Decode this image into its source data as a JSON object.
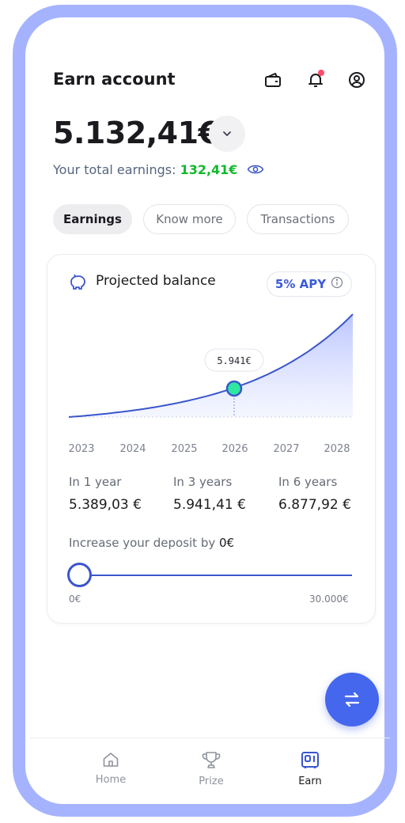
{
  "header": {
    "title": "Earn account",
    "balance": "5.132,41€",
    "earnings_label": "Your total earnings:",
    "earnings_value": "132,41€"
  },
  "tabs": [
    {
      "label": "Earnings",
      "active": true
    },
    {
      "label": "Know more",
      "active": false
    },
    {
      "label": "Transactions",
      "active": false
    }
  ],
  "card": {
    "title": "Projected balance",
    "apy": "5% APY",
    "tooltip_value": "5.941€",
    "years": [
      "2023",
      "2024",
      "2025",
      "2026",
      "2027",
      "2028"
    ],
    "stats": [
      {
        "label": "In 1 year",
        "value": "5.389,03 €"
      },
      {
        "label": "In 3 years",
        "value": "5.941,41 €"
      },
      {
        "label": "In 6 years",
        "value": "6.877,92 €"
      }
    ],
    "deposit_label": "Increase your deposit by",
    "deposit_value": "0€",
    "slider_min": "0€",
    "slider_max": "30.000€",
    "slider_fraction": 0
  },
  "nav": [
    {
      "label": "Home",
      "icon": "home-icon",
      "active": false
    },
    {
      "label": "Prize",
      "icon": "trophy-icon",
      "active": false
    },
    {
      "label": "Earn",
      "icon": "safe-icon",
      "active": true
    }
  ],
  "colors": {
    "frame": "#a5b3ff",
    "accent": "#3a56cc",
    "earnings": "#12b82d",
    "highlight_point": "#2ee8a0",
    "notification": "#ff4c6a"
  }
}
